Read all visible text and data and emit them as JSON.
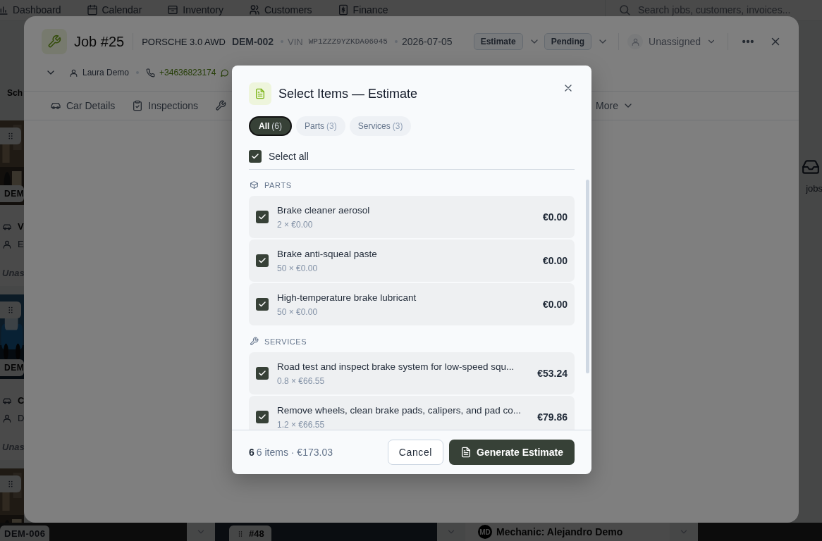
{
  "nav": {
    "items": [
      {
        "label": "Dashboard"
      },
      {
        "label": "Calendar"
      },
      {
        "label": "Inventory"
      },
      {
        "label": "Customers"
      },
      {
        "label": "Finance"
      }
    ],
    "search": {
      "placeholder": "Search jobs, customers, invoices..."
    }
  },
  "board": {
    "side_label": "Sch",
    "cards": [
      {
        "plate": "DEM",
        "vehicle": "V",
        "customer": "E",
        "assignee": "Unas",
        "kind": "workshop"
      },
      {
        "plate": "DEM",
        "vehicle": "C",
        "customer": "D",
        "assignee": "Unas",
        "kind": "car"
      },
      {
        "kind": "workshop"
      }
    ],
    "empty_state": "jobs",
    "bottom": {
      "plate": "DEM-006",
      "job_number": "#48",
      "mechanic_initials": "MD",
      "mechanic": "Mechanic: Alejandro Demo"
    }
  },
  "job": {
    "title": "Job #25",
    "vehicle": "PORSCHE 3.0 AWD",
    "plate": "DEM-002",
    "vin_label": "VIN",
    "vin": "WP1ZZZ9YZKDA06045",
    "date": "2026-07-05",
    "type": "Estimate",
    "status": "Pending",
    "assignee": "Unassigned",
    "customer": "Laura Demo",
    "phone": "+34636823174",
    "tabs": [
      {
        "kind": "car",
        "label": "Car Details"
      },
      {
        "kind": "clipboard",
        "label": "Inspections"
      },
      {
        "kind": "wrench"
      },
      {
        "kind": "more",
        "label": "More"
      }
    ]
  },
  "dialog": {
    "title": "Select Items — Estimate",
    "filters": [
      {
        "label": "All",
        "count": "(6)",
        "selected": true
      },
      {
        "label": "Parts",
        "count": "(3)",
        "selected": false
      },
      {
        "label": "Services",
        "count": "(3)",
        "selected": false
      }
    ],
    "select_all": {
      "label": "Select all",
      "checked": true
    },
    "sections": [
      {
        "kind": "parts",
        "title": "PARTS",
        "items": [
          {
            "name": "Brake cleaner aerosol",
            "quantity": "2 × €0.00",
            "price": "€0.00",
            "checked": true
          },
          {
            "name": "Brake anti-squeal paste",
            "quantity": "50 × €0.00",
            "price": "€0.00",
            "checked": true
          },
          {
            "name": "High-temperature brake lubricant",
            "quantity": "50 × €0.00",
            "price": "€0.00",
            "checked": true
          }
        ]
      },
      {
        "kind": "services",
        "title": "SERVICES",
        "items": [
          {
            "name": "Road test and inspect brake system for low-speed squ...",
            "quantity": "0.8 × €66.55",
            "price": "€53.24",
            "checked": true
          },
          {
            "name": "Remove wheels, clean brake pads, calipers, and pad co...",
            "quantity": "1.2 × €66.55",
            "price": "€79.86",
            "checked": true
          }
        ]
      }
    ],
    "footer": {
      "count": "6",
      "summary": "6 items · €173.03"
    },
    "buttons": [
      {
        "kind": "secondary",
        "label": "Cancel"
      },
      {
        "kind": "primary",
        "label": "Generate Estimate"
      }
    ]
  }
}
